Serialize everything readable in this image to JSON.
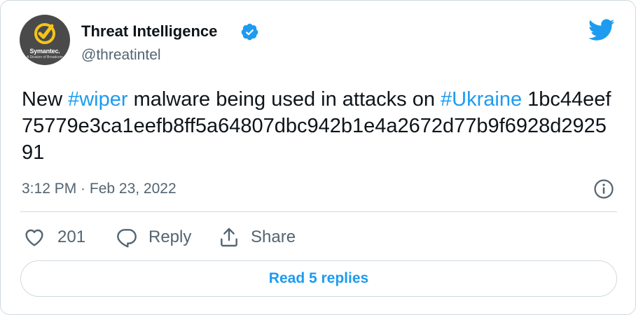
{
  "colors": {
    "accent": "#1d9bf0",
    "text": "#0f1419",
    "secondary": "#536471",
    "border": "#cfd9de",
    "avatar_bg": "#4a4a4a",
    "logo_yellow": "#f5c518"
  },
  "author": {
    "display_name": "Threat Intelligence",
    "handle": "@threatintel",
    "verified_icon": "verified-badge-icon",
    "avatar": {
      "brand": "Symantec.",
      "tagline": "A Division of Broadcom"
    }
  },
  "platform_icon": "twitter-bird-icon",
  "tweet": {
    "text_parts": {
      "p1": "New ",
      "hashtag1": "#wiper",
      "p2": " malware being used in attacks on ",
      "hashtag2": "#Ukraine",
      "p3": " 1bc44eef75779e3ca1eefb8ff5a64807dbc942b1e4a2672d77b9f6928d292591"
    },
    "timestamp": "3:12 PM · Feb 23, 2022"
  },
  "actions": {
    "like_count": "201",
    "reply_label": "Reply",
    "share_label": "Share"
  },
  "read_replies_label": "Read 5 replies"
}
